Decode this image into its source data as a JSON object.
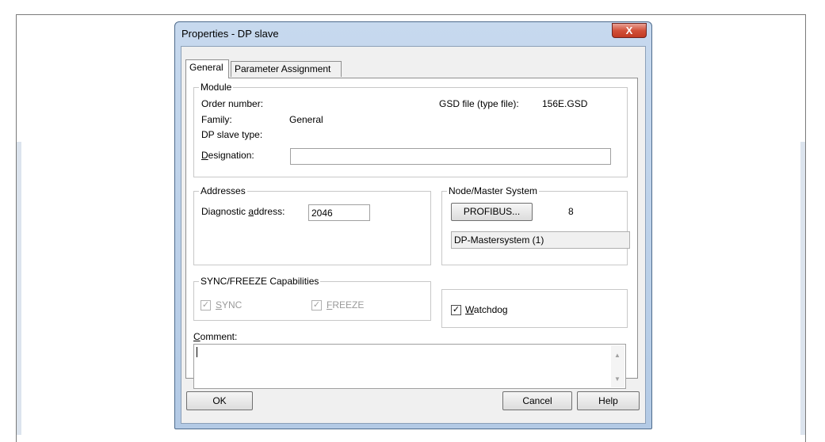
{
  "dialog": {
    "title": "Properties - DP slave",
    "close_label": "X"
  },
  "tabs": [
    "General",
    "Parameter Assignment"
  ],
  "module": {
    "legend": "Module",
    "order_number_label": "Order number:",
    "gsd_label": "GSD file (type file):",
    "gsd_value": "156E.GSD",
    "family_label": "Family:",
    "family_value": "General",
    "dp_slave_type_label": "DP slave type:",
    "designation_label": "Designation:",
    "designation_value": ""
  },
  "addresses": {
    "legend": "Addresses",
    "diag_label": "Diagnostic address:",
    "diag_value": "2046"
  },
  "node": {
    "legend": "Node/Master System",
    "profibus_label": "PROFIBUS...",
    "node_address": "8",
    "master_system": "DP-Mastersystem (1)"
  },
  "sync": {
    "legend": "SYNC/FREEZE Capabilities",
    "sync_label": "SYNC",
    "freeze_label": "FREEZE"
  },
  "watchdog": {
    "label": "Watchdog",
    "checked": true
  },
  "comment": {
    "label": "Comment:",
    "value": ""
  },
  "buttons": {
    "ok": "OK",
    "cancel": "Cancel",
    "help": "Help"
  }
}
